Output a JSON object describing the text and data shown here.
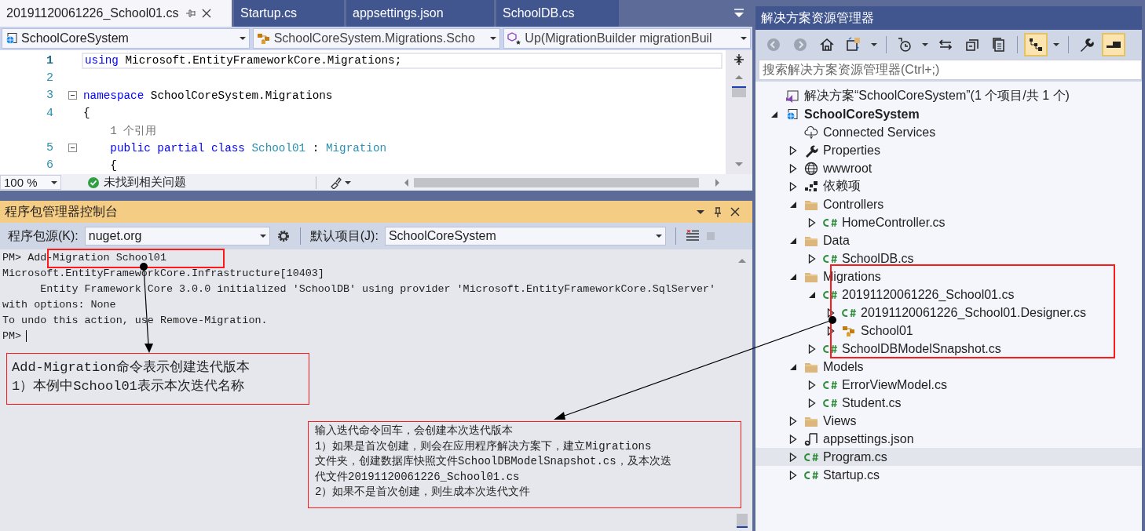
{
  "editor_tabs": [
    {
      "label": "20191120061226_School01.cs",
      "selected": true
    },
    {
      "label": "Startup.cs",
      "selected": false
    },
    {
      "label": "appsettings.json",
      "selected": false
    },
    {
      "label": "SchoolDB.cs",
      "selected": false
    }
  ],
  "nav_bar": [
    {
      "kind": "project",
      "text": "SchoolCoreSystem"
    },
    {
      "kind": "class",
      "text": "SchoolCoreSystem.Migrations.Scho"
    },
    {
      "kind": "method",
      "text": "Up(MigrationBuilder migrationBuil"
    }
  ],
  "code_lines": [
    {
      "kind": "code",
      "number": "1",
      "current": true,
      "fold": false,
      "tokens": [
        {
          "kind": "keyword",
          "text": "using"
        },
        {
          "kind": "plain",
          "text": " Microsoft.EntityFrameworkCore.Migrations;"
        }
      ]
    },
    {
      "kind": "code",
      "number": "2",
      "current": false,
      "fold": false
    },
    {
      "kind": "code",
      "number": "3",
      "current": false,
      "fold": true,
      "tokens": [
        {
          "kind": "keyword",
          "text": "namespace"
        },
        {
          "kind": "plain",
          "text": " SchoolCoreSystem.Migrations"
        }
      ]
    },
    {
      "kind": "code",
      "number": "4",
      "current": false,
      "fold": false,
      "tokens": [
        {
          "kind": "plain",
          "text": "{"
        }
      ]
    },
    {
      "kind": "codelens",
      "current": false,
      "fold": false,
      "tokens": [
        {
          "kind": "lens",
          "text": "    1 个引用"
        }
      ]
    },
    {
      "kind": "code",
      "number": "5",
      "current": false,
      "fold": true,
      "tokens": [
        {
          "kind": "keyword",
          "text": "    public partial class "
        },
        {
          "kind": "type",
          "text": "School01"
        },
        {
          "kind": "plain",
          "text": " : "
        },
        {
          "kind": "type",
          "text": "Migration"
        }
      ]
    },
    {
      "kind": "code",
      "number": "6",
      "current": false,
      "fold": false,
      "tokens": [
        {
          "kind": "plain",
          "text": "    {"
        }
      ]
    }
  ],
  "editor_status": {
    "zoom": "100 %",
    "issues": "未找到相关问题"
  },
  "package_console": {
    "title": "程序包管理器控制台",
    "source_label": "程序包源(K):",
    "source": "nuget.org",
    "project_label": "默认项目(J):",
    "project": "SchoolCoreSystem",
    "lines": [
      {
        "text": "PM> Add-Migration School01",
        "cursor": false
      },
      {
        "text": "Microsoft.EntityFrameworkCore.Infrastructure[10403]",
        "cursor": false
      },
      {
        "text": "      Entity Framework Core 3.0.0 initialized 'SchoolDB' using provider 'Microsoft.EntityFrameworkCore.SqlServer'",
        "cursor": false
      },
      {
        "text": "with options: None",
        "cursor": false
      },
      {
        "text": "To undo this action, use Remove-Migration.",
        "cursor": false
      },
      {
        "text": "PM>",
        "cursor": true
      }
    ]
  },
  "solution_explorer": {
    "title": "解决方案资源管理器",
    "toolbar": [
      [
        {
          "kind": "back",
          "disabled": true,
          "selected": false
        },
        {
          "kind": "forward",
          "disabled": true,
          "selected": false
        },
        {
          "kind": "home",
          "disabled": false,
          "selected": false
        },
        {
          "kind": "sync",
          "disabled": false,
          "selected": false
        },
        {
          "kind": "dropdown",
          "disabled": false,
          "selected": false
        }
      ],
      [
        {
          "kind": "history",
          "disabled": false,
          "selected": false
        },
        {
          "kind": "dropdown",
          "disabled": false,
          "selected": false
        },
        {
          "kind": "swap",
          "disabled": false,
          "selected": false
        },
        {
          "kind": "collapse",
          "disabled": false,
          "selected": false
        },
        {
          "kind": "copy",
          "disabled": false,
          "selected": false
        }
      ],
      [
        {
          "kind": "tree",
          "disabled": false,
          "selected": true
        },
        {
          "kind": "dropdown",
          "disabled": false,
          "selected": false
        }
      ],
      [
        {
          "kind": "wrench",
          "disabled": false,
          "selected": false
        },
        {
          "kind": "preview",
          "disabled": false,
          "selected": true
        }
      ]
    ],
    "search": {
      "placeholder": "搜索解决方案资源管理器(Ctrl+;)"
    },
    "tree": [
      {
        "kind": "solution",
        "label": "解决方案“SchoolCoreSystem”(1 个项目/共 1 个)",
        "selected": false
      },
      {
        "kind": "project",
        "label": "SchoolCoreSystem",
        "expanded": true,
        "selected": false,
        "children": [
          {
            "kind": "connected",
            "label": "Connected Services",
            "selected": false
          },
          {
            "kind": "wrench",
            "label": "Properties",
            "expanded": false,
            "selected": false
          },
          {
            "kind": "globe",
            "label": "wwwroot",
            "expanded": false,
            "selected": false
          },
          {
            "kind": "deps",
            "label": "依赖项",
            "expanded": false,
            "selected": false
          },
          {
            "kind": "folder",
            "label": "Controllers",
            "expanded": true,
            "selected": false,
            "children": [
              {
                "kind": "csharp",
                "label": "HomeController.cs",
                "expanded": false,
                "selected": false
              }
            ]
          },
          {
            "kind": "folder",
            "label": "Data",
            "expanded": true,
            "selected": false,
            "children": [
              {
                "kind": "csharp",
                "label": "SchoolDB.cs",
                "expanded": false,
                "selected": false
              }
            ]
          },
          {
            "kind": "folder",
            "label": "Migrations",
            "expanded": true,
            "selected": false,
            "children": [
              {
                "kind": "csharp",
                "label": "20191120061226_School01.cs",
                "expanded": true,
                "selected": false,
                "children": [
                  {
                    "kind": "csharp",
                    "label": "20191120061226_School01.Designer.cs",
                    "expanded": false,
                    "selected": false
                  },
                  {
                    "kind": "class",
                    "label": "School01",
                    "expanded": false,
                    "selected": false
                  }
                ]
              },
              {
                "kind": "csharp",
                "label": "SchoolDBModelSnapshot.cs",
                "expanded": false,
                "selected": false
              }
            ]
          },
          {
            "kind": "folder",
            "label": "Models",
            "expanded": true,
            "selected": false,
            "children": [
              {
                "kind": "csharp",
                "label": "ErrorViewModel.cs",
                "expanded": false,
                "selected": false
              },
              {
                "kind": "csharp",
                "label": "Student.cs",
                "expanded": false,
                "selected": false
              }
            ]
          },
          {
            "kind": "folder",
            "label": "Views",
            "expanded": false,
            "selected": false
          },
          {
            "kind": "json",
            "label": "appsettings.json",
            "expanded": false,
            "selected": false
          },
          {
            "kind": "csharp",
            "label": "Program.cs",
            "expanded": false,
            "selected": true
          },
          {
            "kind": "csharp",
            "label": "Startup.cs",
            "expanded": false,
            "selected": false
          }
        ]
      }
    ]
  },
  "annotations": [
    {
      "lines": [
        "Add-Migration命令表示创建迭代版本",
        "1）本例中School01表示本次迭代名称"
      ]
    },
    {
      "lines": [
        "输入迭代命令回车，会创建本次迭代版本",
        "1）如果是首次创建，则会在应用程序解决方案下，建立Migrations",
        "文件夹，创建数据库快照文件SchoolDBModelSnapshot.cs，及本次迭",
        "代文件20191120061226_School01.cs",
        "2）如果不是首次创建，则生成本次迭代文件"
      ]
    }
  ]
}
